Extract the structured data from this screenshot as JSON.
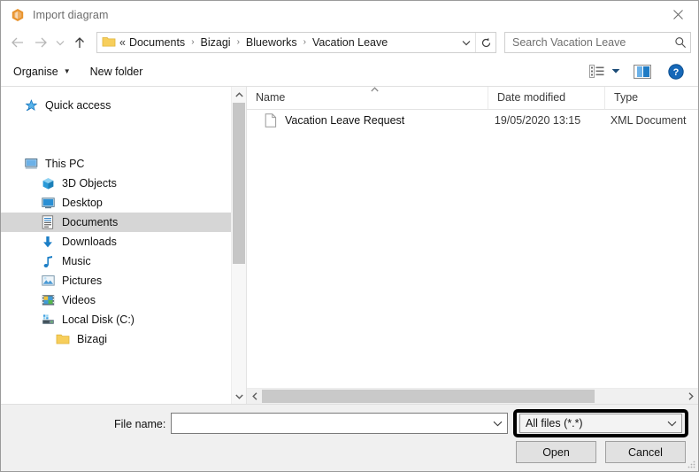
{
  "window": {
    "title": "Import diagram",
    "app_icon": "bizagi-hexagon-icon",
    "close_label": "×",
    "accent_orange": "#E8922B",
    "accent_blue": "#1f7bc4"
  },
  "navbar": {
    "back_icon": "arrow-left-icon",
    "forward_icon": "arrow-right-icon",
    "recent_icon": "chevron-down-icon",
    "up_icon": "arrow-up-icon",
    "address": {
      "lead": "«",
      "crumbs": [
        "Documents",
        "Bizagi",
        "Blueworks",
        "Vacation Leave"
      ],
      "separator": "›",
      "dropdown_icon": "chevron-down-icon",
      "refresh_icon": "refresh-icon"
    },
    "search": {
      "placeholder": "Search Vacation Leave",
      "value": "",
      "icon": "search-icon"
    }
  },
  "toolbar": {
    "organise_label": "Organise",
    "organise_caret": "▼",
    "new_folder_label": "New folder",
    "view_icon": "view-options-icon",
    "view_caret": "▼",
    "preview_pane_icon": "preview-pane-icon",
    "help_icon": "help-icon",
    "help_glyph": "?"
  },
  "sidebar": {
    "items": [
      {
        "label": "Quick access",
        "icon": "star-icon",
        "indent": 0,
        "selected": false
      },
      {
        "label": "This PC",
        "icon": "monitor-icon",
        "indent": 0,
        "selected": false
      },
      {
        "label": "3D Objects",
        "icon": "cube-icon",
        "indent": 1,
        "selected": false
      },
      {
        "label": "Desktop",
        "icon": "desktop-icon",
        "indent": 1,
        "selected": false
      },
      {
        "label": "Documents",
        "icon": "documents-icon",
        "indent": 1,
        "selected": true
      },
      {
        "label": "Downloads",
        "icon": "download-arrow-icon",
        "indent": 1,
        "selected": false
      },
      {
        "label": "Music",
        "icon": "music-note-icon",
        "indent": 1,
        "selected": false
      },
      {
        "label": "Pictures",
        "icon": "pictures-icon",
        "indent": 1,
        "selected": false
      },
      {
        "label": "Videos",
        "icon": "video-icon",
        "indent": 1,
        "selected": false
      },
      {
        "label": "Local Disk (C:)",
        "icon": "hard-disk-icon",
        "indent": 1,
        "selected": false
      },
      {
        "label": "Bizagi",
        "icon": "folder-icon",
        "indent": 2,
        "selected": false
      }
    ],
    "scroll_up_icon": "chevron-up-icon",
    "scroll_down_icon": "chevron-down-icon"
  },
  "filelist": {
    "columns": [
      "Name",
      "Date modified",
      "Type"
    ],
    "sort_column": "Name",
    "sort_caret": "▲",
    "rows": [
      {
        "name": "Vacation Leave Request",
        "date_modified": "19/05/2020 13:15",
        "type": "XML Document",
        "icon": "xml-file-icon"
      }
    ],
    "hscroll_left_icon": "chevron-left-icon",
    "hscroll_right_icon": "chevron-right-icon"
  },
  "footer": {
    "filename_label": "File name:",
    "filename_value": "",
    "filename_placeholder": "",
    "filename_caret": "⌄",
    "filter_value": "All files (*.*)",
    "filter_caret": "⌄",
    "open_label": "Open",
    "cancel_label": "Cancel"
  }
}
